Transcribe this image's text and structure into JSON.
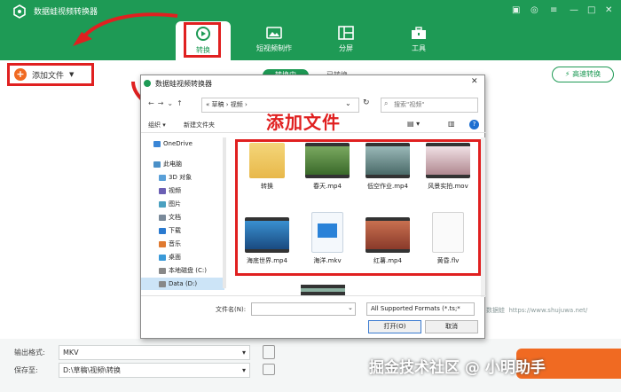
{
  "app": {
    "title": "数据蛙视频转换器"
  },
  "nav": {
    "tabs": [
      {
        "label": "转换",
        "icon": "convert-icon",
        "active": true
      },
      {
        "label": "短视频制作",
        "icon": "short-video-icon"
      },
      {
        "label": "分屏",
        "icon": "split-screen-icon"
      },
      {
        "label": "工具",
        "icon": "toolbox-icon"
      }
    ]
  },
  "toolbar": {
    "add_file": "添加文件",
    "tab_converting": "转换中",
    "tab_converted": "已转换",
    "high_speed": "高速转换"
  },
  "bottom": {
    "output_format_label": "输出格式:",
    "output_format_value": "MKV",
    "save_to_label": "保存至:",
    "save_to_value": "D:\\草稿\\视频\\转换"
  },
  "dialog": {
    "title": "数据蛙视频转换器",
    "breadcrumb": [
      "«",
      "草稿",
      "视频"
    ],
    "search_placeholder": "搜索\"视频\"",
    "organize": "组织 ▾",
    "new_folder": "新建文件夹",
    "sidebar": [
      {
        "label": "OneDrive",
        "icon": "cloud-icon"
      },
      {
        "label": "此电脑",
        "icon": "computer-icon"
      },
      {
        "label": "3D 对象",
        "icon": "3d-objects-icon"
      },
      {
        "label": "视频",
        "icon": "video-folder-icon"
      },
      {
        "label": "图片",
        "icon": "pictures-icon"
      },
      {
        "label": "文档",
        "icon": "documents-icon"
      },
      {
        "label": "下载",
        "icon": "download-icon"
      },
      {
        "label": "音乐",
        "icon": "music-icon"
      },
      {
        "label": "桌面",
        "icon": "desktop-icon"
      },
      {
        "label": "本地磁盘 (C:)",
        "icon": "disk-icon"
      },
      {
        "label": "Data (D:)",
        "icon": "disk-icon"
      }
    ],
    "files": [
      {
        "name": "转换",
        "kind": "folder"
      },
      {
        "name": "春天.mp4",
        "kind": "video"
      },
      {
        "name": "低空作业.mp4",
        "kind": "video"
      },
      {
        "name": "风景实拍.mov",
        "kind": "video"
      },
      {
        "name": "海底世界.mp4",
        "kind": "video"
      },
      {
        "name": "海洋.mkv",
        "kind": "clapper"
      },
      {
        "name": "红薯.mp4",
        "kind": "video"
      },
      {
        "name": "黄昏.flv",
        "kind": "blank"
      }
    ],
    "filename_label": "文件名(N):",
    "format_value": "All Supported Formats (*.ts;*",
    "open_button": "打开(O)",
    "cancel_button": "取消"
  },
  "annotation": "添加文件",
  "watermarks": {
    "site": "https://www.shujuwa.net/",
    "brand": "数据蛙",
    "community": "掘金技术社区 @ 小明助手"
  },
  "colors": {
    "brand_green": "#1e9a55",
    "accent_orange": "#f06a22",
    "annotation_red": "#e02020"
  }
}
